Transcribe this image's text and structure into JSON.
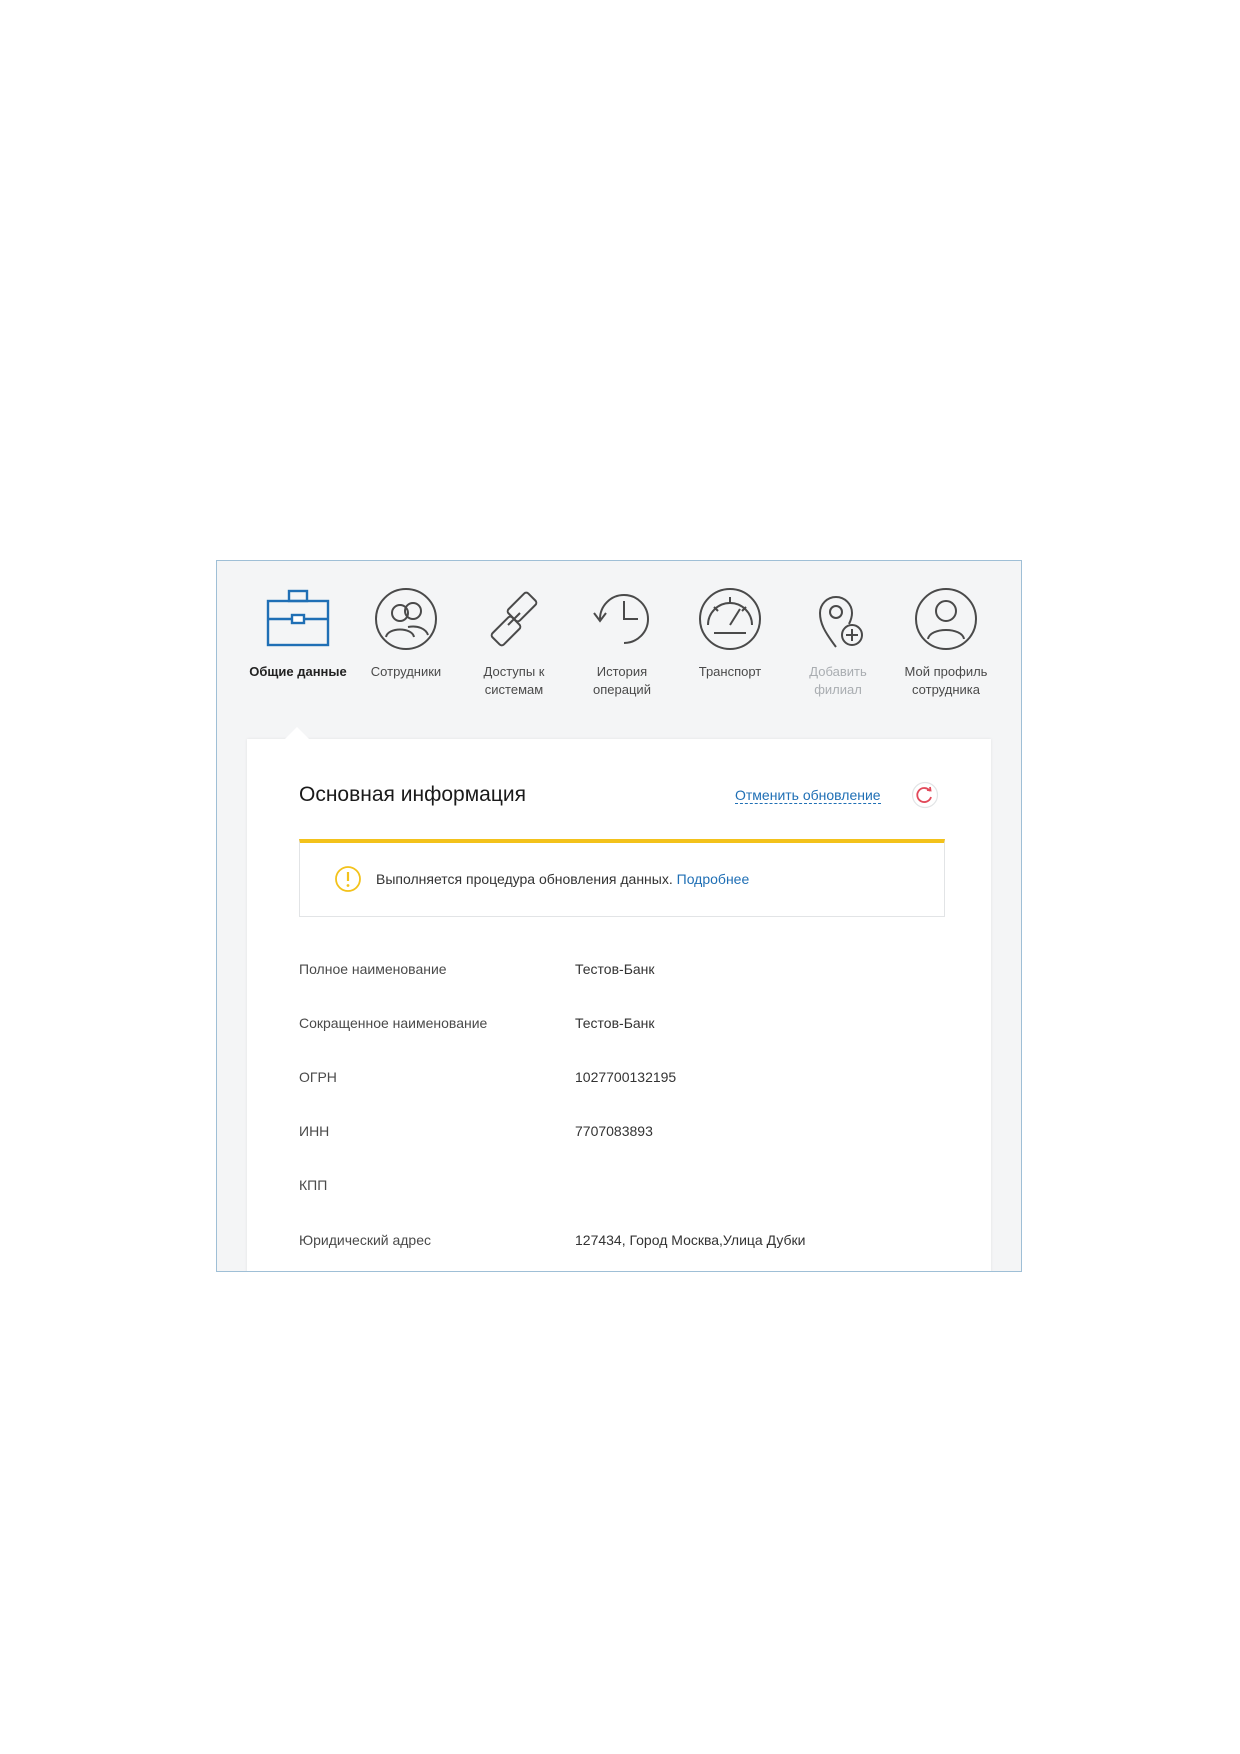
{
  "colors": {
    "accent": "#1f6fb5",
    "warning": "#f3c21b",
    "refresh": "#e2495a",
    "icon_stroke": "#4a4a4a",
    "disabled": "#a9adb1"
  },
  "tabs": [
    {
      "label": "Общие данные",
      "icon": "briefcase-icon",
      "active": true
    },
    {
      "label": "Сотрудники",
      "icon": "employees-icon"
    },
    {
      "label": "Доступы к\nсистемам",
      "icon": "link-icon"
    },
    {
      "label": "История\nопераций",
      "icon": "history-icon"
    },
    {
      "label": "Транспорт",
      "icon": "speedometer-icon"
    },
    {
      "label": "Добавить\nфилиал",
      "icon": "location-add-icon",
      "disabled": true
    },
    {
      "label": "Мой профиль\nсотрудника",
      "icon": "user-profile-icon"
    }
  ],
  "panel": {
    "title": "Основная информация",
    "cancel_update_label": "Отменить обновление",
    "notice": {
      "text": "Выполняется процедура обновления данных.",
      "link": "Подробнее"
    },
    "fields": [
      {
        "label": "Полное наименование",
        "value": "Тестов-Банк"
      },
      {
        "label": "Сокращенное наименование",
        "value": "Тестов-Банк"
      },
      {
        "label": "ОГРН",
        "value": "1027700132195"
      },
      {
        "label": "ИНН",
        "value": "7707083893"
      },
      {
        "label": "КПП",
        "value": ""
      },
      {
        "label": "Юридический адрес",
        "value": "127434, Город Москва,Улица Дубки"
      }
    ]
  }
}
